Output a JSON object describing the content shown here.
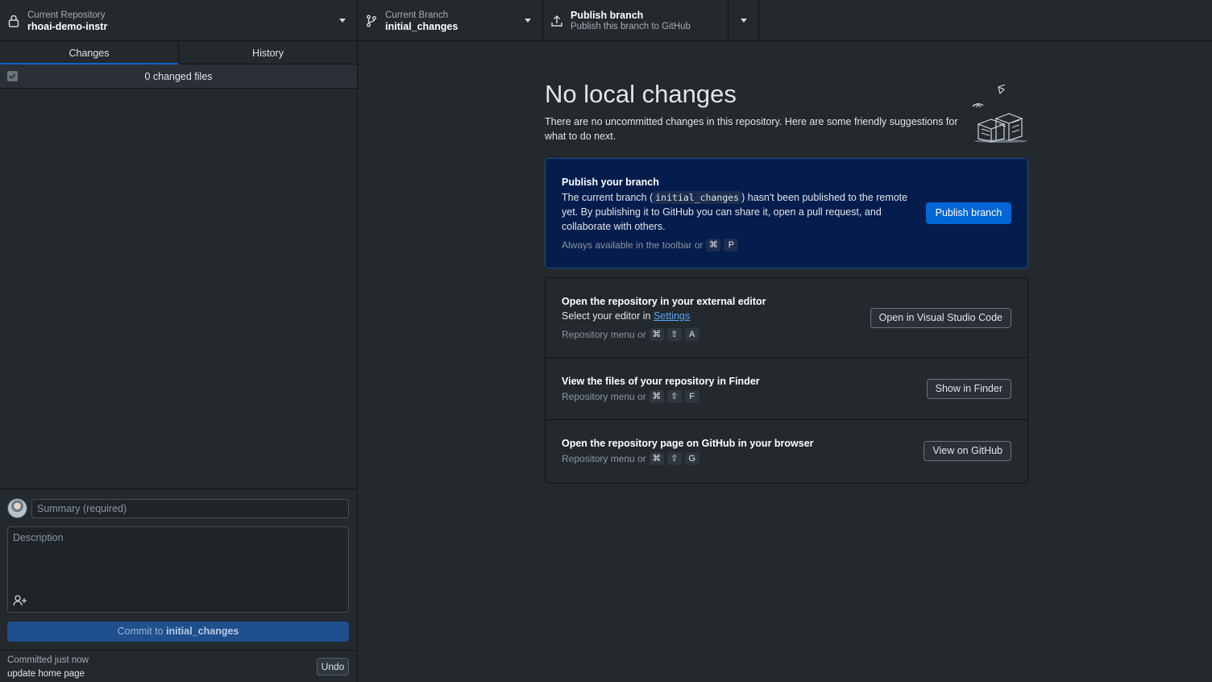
{
  "toolbar": {
    "repo": {
      "label": "Current Repository",
      "value": "rhoai-demo-instr",
      "icon": "lock-icon"
    },
    "branch": {
      "label": "Current Branch",
      "value": "initial_changes",
      "icon": "git-branch-icon"
    },
    "publish": {
      "label": "Publish branch",
      "sublabel": "Publish this branch to GitHub",
      "icon": "upload-icon"
    }
  },
  "sidebar": {
    "tabs": [
      {
        "label": "Changes",
        "active": true
      },
      {
        "label": "History",
        "active": false
      }
    ],
    "changed_files": "0 changed files",
    "commit": {
      "summary_placeholder": "Summary (required)",
      "description_placeholder": "Description",
      "button_prefix": "Commit to ",
      "button_branch": "initial_changes"
    },
    "last_commit": {
      "when": "Committed just now",
      "message": "update home page",
      "undo_label": "Undo"
    }
  },
  "main": {
    "title": "No local changes",
    "subtitle": "There are no uncommitted changes in this repository. Here are some friendly suggestions for what to do next.",
    "publish_card": {
      "title": "Publish your branch",
      "desc_before": "The current branch (",
      "branch_code": "initial_changes",
      "desc_after": ") hasn't been published to the remote yet. By publishing it to GitHub you can share it, open a pull request, and collaborate with others.",
      "hint": "Always available in the toolbar or",
      "keys": [
        "⌘",
        "P"
      ],
      "button": "Publish branch"
    },
    "actions": [
      {
        "title": "Open the repository in your external editor",
        "sub_before": "Select your editor in ",
        "sub_link": "Settings",
        "hint": "Repository menu or",
        "keys": [
          "⌘",
          "⇧",
          "A"
        ],
        "button": "Open in Visual Studio Code"
      },
      {
        "title": "View the files of your repository in Finder",
        "hint": "Repository menu or",
        "keys": [
          "⌘",
          "⇧",
          "F"
        ],
        "button": "Show in Finder"
      },
      {
        "title": "Open the repository page on GitHub in your browser",
        "hint": "Repository menu or",
        "keys": [
          "⌘",
          "⇧",
          "G"
        ],
        "button": "View on GitHub"
      }
    ]
  },
  "colors": {
    "accent": "#0366d6",
    "background": "#24292e",
    "publish_card_bg": "#051d4d"
  }
}
